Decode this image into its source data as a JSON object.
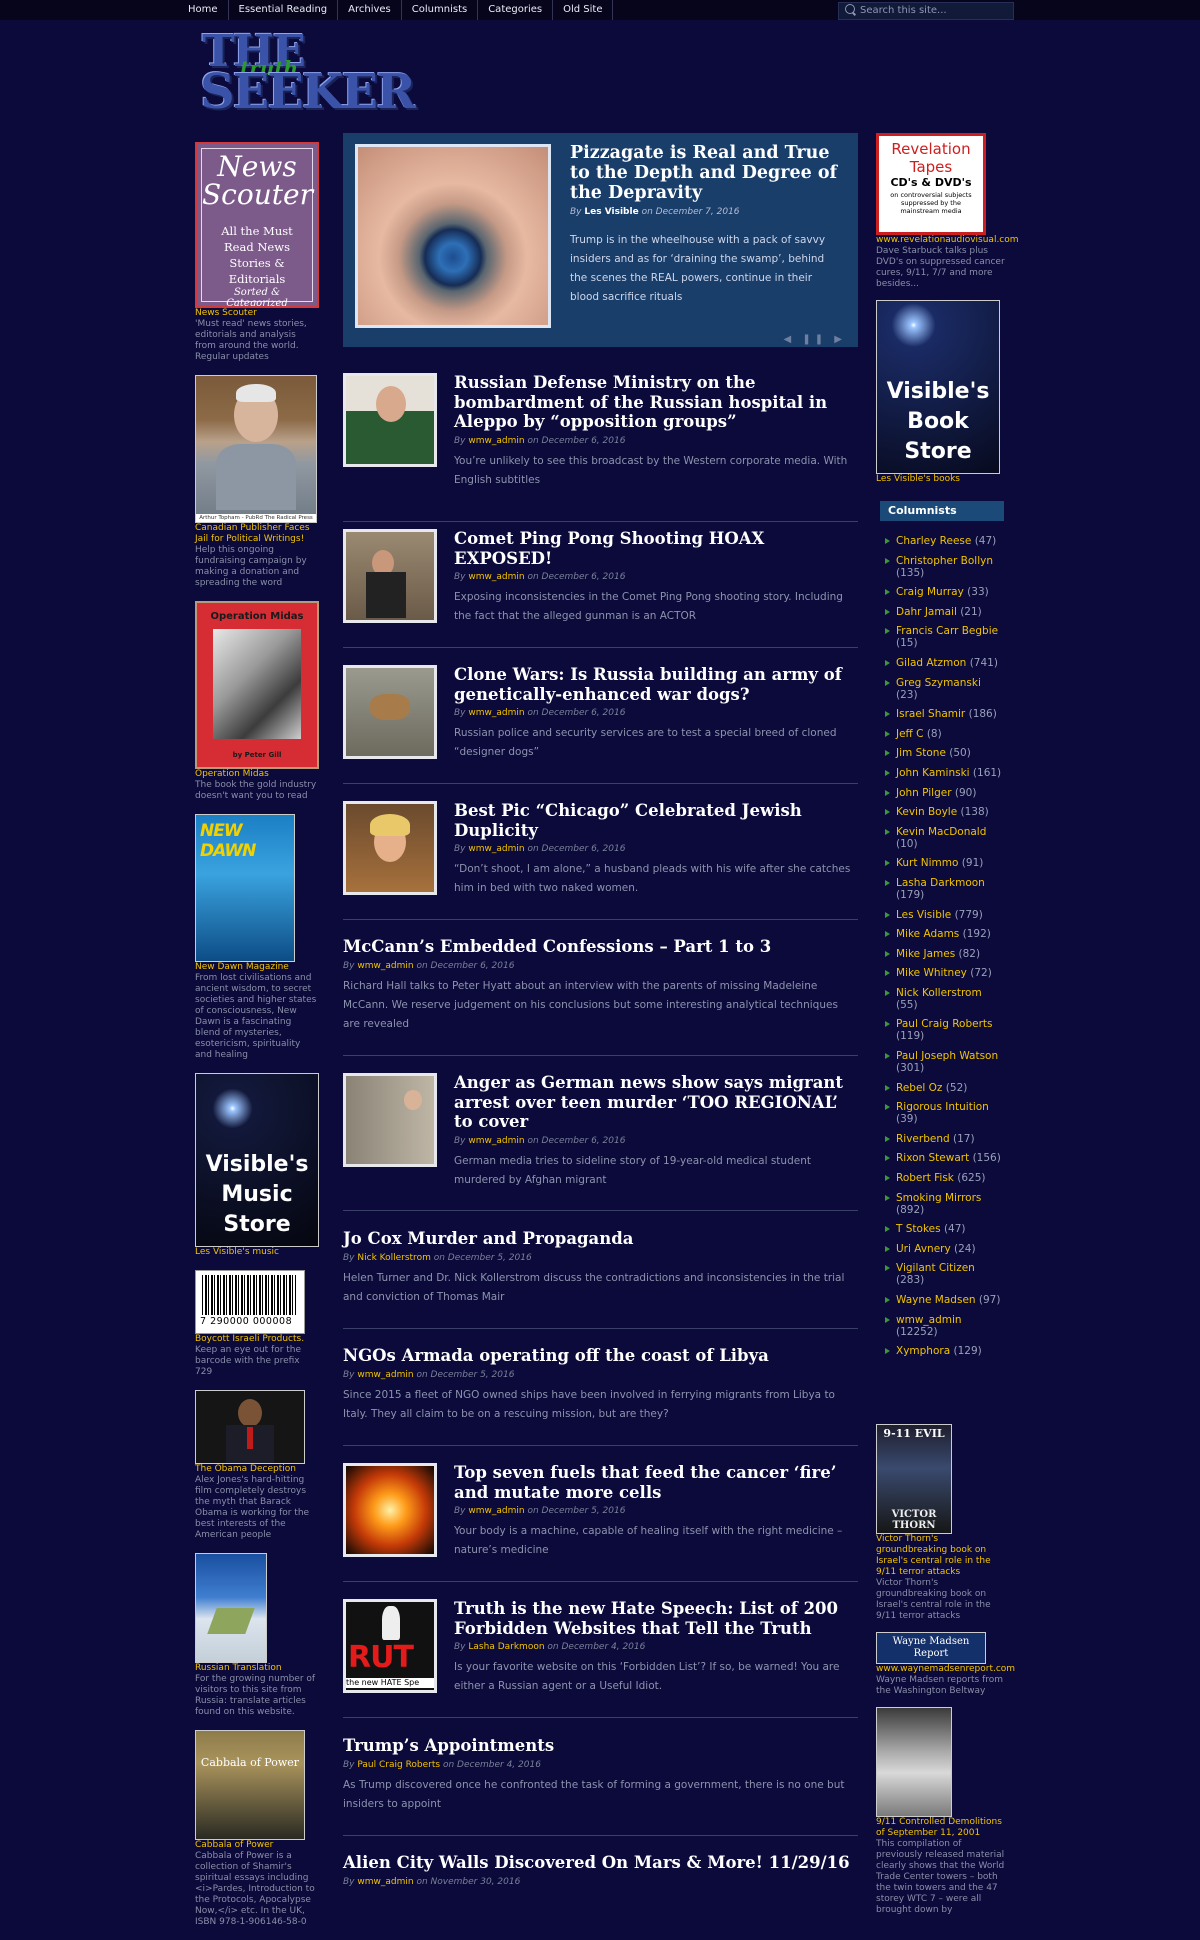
{
  "nav": [
    "Home",
    "Essential Reading",
    "Archives",
    "Columnists",
    "Categories",
    "Old Site"
  ],
  "search_placeholder": "Search this site...",
  "logo": {
    "the": "THE",
    "truth": "truth",
    "seeker": "SEEKER"
  },
  "left_ads": [
    {
      "title_line1": "News",
      "title_line2": "Scouter",
      "body": "All the Must Read News Stories & Editorials",
      "sub": "Sorted & Categorized",
      "cap": "News Scouter",
      "desc": "'Must read' news stories, editorials and analysis from around the world. Regular updates"
    },
    {
      "photo_caption": "Arthur Topham - PubRd The Radical Press",
      "cap": "Canadian Publisher Faces Jail for Political Writings!",
      "desc": "Help this ongoing fundraising campaign by making a donation and spreading the word"
    },
    {
      "banner": "Operation Midas",
      "byline": "by Peter Gill",
      "cap": "Operation Midas",
      "desc": "The book the gold industry doesn't want you to read"
    },
    {
      "banner": "NEW DAWN",
      "cap": "New Dawn Magazine",
      "desc": "From lost civilisations and ancient wisdom, to secret societies and higher states of consciousness, New Dawn is a fascinating blend of mysteries, esotericism, spirituality and healing"
    },
    {
      "line1": "Visible's",
      "line2": "Music",
      "line3": "Store",
      "cap": "Les Visible's music",
      "desc": ""
    },
    {
      "barcode": "7 290000 000008",
      "cap": "Boycott Israeli Products.",
      "desc": "Keep an eye out for the barcode with the prefix 729"
    },
    {
      "cap": "The Obama Deception",
      "desc": "Alex Jones's hard-hitting film completely destroys the myth that Barack Obama is working for the best interests of the American people"
    },
    {
      "cap": "Russian Translation",
      "desc": "For the growing number of visitors to this site from Russia: translate articles found on this website."
    },
    {
      "cover": "Cabbala of Power",
      "cap": "Cabbala of Power",
      "desc": "Cabbala of Power is a collection of Shamir's spiritual essays including <i>Pardes, Introduction to the Protocols, Apocalypse Now,</i> etc. In the UK, ISBN 978-1-906146-58-0"
    }
  ],
  "featured": {
    "title": "Pizzagate is Real and True to the Depth and Degree of the Depravity",
    "by": "By",
    "author": "Les Visible",
    "date": "on December 7, 2016",
    "excerpt": "Trump is in the wheelhouse with a pack of savvy insiders and as for ‘draining the swamp’, behind the scenes the REAL powers, continue in their blood sacrifice rituals",
    "controls": "◀ ❚❚ ▶"
  },
  "posts": [
    {
      "title": "Russian Defense Ministry on the bombardment of the Russian hospital in Aleppo by “opposition groups”",
      "author": "wmw_admin",
      "date": "on December 6, 2016",
      "excerpt": "You’re unlikely to see this broadcast by the Western corporate media. With English subtitles"
    },
    {
      "title": "Comet Ping Pong Shooting HOAX EXPOSED!",
      "author": "wmw_admin",
      "date": "on December 6, 2016",
      "excerpt": "Exposing inconsistencies in the Comet Ping Pong shooting story. Including the fact that the alleged gunman is an ACTOR"
    },
    {
      "title": "Clone Wars: Is Russia building an army of genetically-enhanced war dogs?",
      "author": "wmw_admin",
      "date": "on December 6, 2016",
      "excerpt": "Russian police and security services are to test a special breed of cloned “designer dogs”"
    },
    {
      "title": "Best Pic “Chicago” Celebrated Jewish Duplicity",
      "author": "wmw_admin",
      "date": "on December 6, 2016",
      "excerpt": "“Don’t shoot, I am alone,” a husband pleads with his wife after she catches him in bed with two naked women."
    },
    {
      "title": "McCann’s Embedded Confessions – Part 1 to 3",
      "author": "wmw_admin",
      "date": "on December 6, 2016",
      "excerpt": "Richard Hall talks to Peter Hyatt about an interview with the parents of missing Madeleine McCann. We reserve judgement on his conclusions but some interesting analytical techniques are revealed"
    },
    {
      "title": "Anger as German news show says migrant arrest over teen murder ‘TOO REGIONAL’ to cover",
      "author": "wmw_admin",
      "date": "on December 6, 2016",
      "excerpt": "German media tries to sideline story of 19-year-old medical student murdered by Afghan migrant"
    },
    {
      "title": "Jo Cox Murder and Propaganda",
      "author": "Nick Kollerstrom",
      "date": "on December 5, 2016",
      "excerpt": "Helen Turner and Dr. Nick Kollerstrom discuss the contradictions and inconsistencies in the trial and conviction of Thomas Mair"
    },
    {
      "title": "NGOs Armada operating off the coast of Libya",
      "author": "wmw_admin",
      "date": "on December 5, 2016",
      "excerpt": "Since 2015 a fleet of NGO owned ships have been involved in ferrying migrants from Libya to Italy. They all claim to be on a rescuing mission, but are they?"
    },
    {
      "title": "Top seven fuels that feed the cancer ‘fire’ and mutate more cells",
      "author": "wmw_admin",
      "date": "on December 5, 2016",
      "excerpt": "Your body is a machine, capable of healing itself with the right medicine – nature’s medicine"
    },
    {
      "title": "Truth is the new Hate Speech: List of 200 Forbidden Websites that Tell the Truth",
      "author": "Lasha Darkmoon",
      "date": "on December 4, 2016",
      "excerpt": "Is your favorite website on this ‘Forbidden List’? If so, be warned! You are either a Russian agent or a Useful Idiot.",
      "thumb_text": "RUT",
      "thumb_sub": "the new HATE Spe"
    },
    {
      "title": "Trump’s Appointments",
      "author": "Paul Craig Roberts",
      "date": "on December 4, 2016",
      "excerpt": "As Trump discovered once he confronted the task of forming a government, there is no one but insiders to appoint"
    },
    {
      "title": "Alien City Walls Discovered On Mars & More! 11/29/16",
      "author": "wmw_admin",
      "date": "on November 30, 2016",
      "excerpt": ""
    }
  ],
  "by_label": "By",
  "right": {
    "revelation": {
      "line1": "Revelation",
      "line2": "Tapes",
      "line3": "CD's & DVD's",
      "line4": "on controversial subjects suppressed by the mainstream media",
      "cap": "www.revelationaudiovisual.com",
      "desc": "Dave Starbuck talks plus DVD's on suppressed cancer cures, 9/11, 7/7 and more besides..."
    },
    "bookstore": {
      "line1": "Visible's",
      "line2": "Book",
      "line3": "Store",
      "cap": "Les Visible's books"
    },
    "columnists_title": "Columnists",
    "columnists": [
      {
        "name": "Charley Reese",
        "count": "(47)"
      },
      {
        "name": "Christopher Bollyn",
        "count": "(135)"
      },
      {
        "name": "Craig Murray",
        "count": "(33)"
      },
      {
        "name": "Dahr Jamail",
        "count": "(21)"
      },
      {
        "name": "Francis Carr Begbie",
        "count": "(15)"
      },
      {
        "name": "Gilad Atzmon",
        "count": "(741)"
      },
      {
        "name": "Greg Szymanski",
        "count": "(23)"
      },
      {
        "name": "Israel Shamir",
        "count": "(186)"
      },
      {
        "name": "Jeff C",
        "count": "(8)"
      },
      {
        "name": "Jim Stone",
        "count": "(50)"
      },
      {
        "name": "John Kaminski",
        "count": "(161)"
      },
      {
        "name": "John Pilger",
        "count": "(90)"
      },
      {
        "name": "Kevin Boyle",
        "count": "(138)"
      },
      {
        "name": "Kevin MacDonald",
        "count": "(10)"
      },
      {
        "name": "Kurt Nimmo",
        "count": "(91)"
      },
      {
        "name": "Lasha Darkmoon",
        "count": "(179)"
      },
      {
        "name": "Les Visible",
        "count": "(779)"
      },
      {
        "name": "Mike Adams",
        "count": "(192)"
      },
      {
        "name": "Mike James",
        "count": "(82)"
      },
      {
        "name": "Mike Whitney",
        "count": "(72)"
      },
      {
        "name": "Nick Kollerstrom",
        "count": "(55)"
      },
      {
        "name": "Paul Craig Roberts",
        "count": "(119)"
      },
      {
        "name": "Paul Joseph Watson",
        "count": "(301)"
      },
      {
        "name": "Rebel Oz",
        "count": "(52)"
      },
      {
        "name": "Rigorous Intuition",
        "count": "(39)"
      },
      {
        "name": "Riverbend",
        "count": "(17)"
      },
      {
        "name": "Rixon Stewart",
        "count": "(156)"
      },
      {
        "name": "Robert Fisk",
        "count": "(625)"
      },
      {
        "name": "Smoking Mirrors",
        "count": "(892)"
      },
      {
        "name": "T Stokes",
        "count": "(47)"
      },
      {
        "name": "Uri Avnery",
        "count": "(24)"
      },
      {
        "name": "Vigilant Citizen",
        "count": "(283)"
      },
      {
        "name": "Wayne Madsen",
        "count": "(97)"
      },
      {
        "name": "wmw_admin",
        "count": "(12252)"
      },
      {
        "name": "Xymphora",
        "count": "(129)"
      }
    ],
    "evil": {
      "top": "9-11 EVIL",
      "bottom": "VICTOR THORN",
      "cap": "Victor Thorn's groundbreaking book on Israel's central role in the 9/11 terror attacks",
      "desc": "Victor Thorn's groundbreaking book on Israel's central role in the 9/11 terror attacks"
    },
    "madsen": {
      "line1": "Wayne Madsen",
      "line2": "Report",
      "cap": "www.waynemadsenreport.com",
      "desc": "Wayne Madsen reports from the Washington Beltway"
    },
    "demolition": {
      "cap": "9/11 Controlled Demolitions of September 11, 2001",
      "desc": "This compilation of previously released material clearly shows that the World Trade Center towers – both the twin towers and the 47 storey WTC 7 – were all brought down by"
    }
  }
}
